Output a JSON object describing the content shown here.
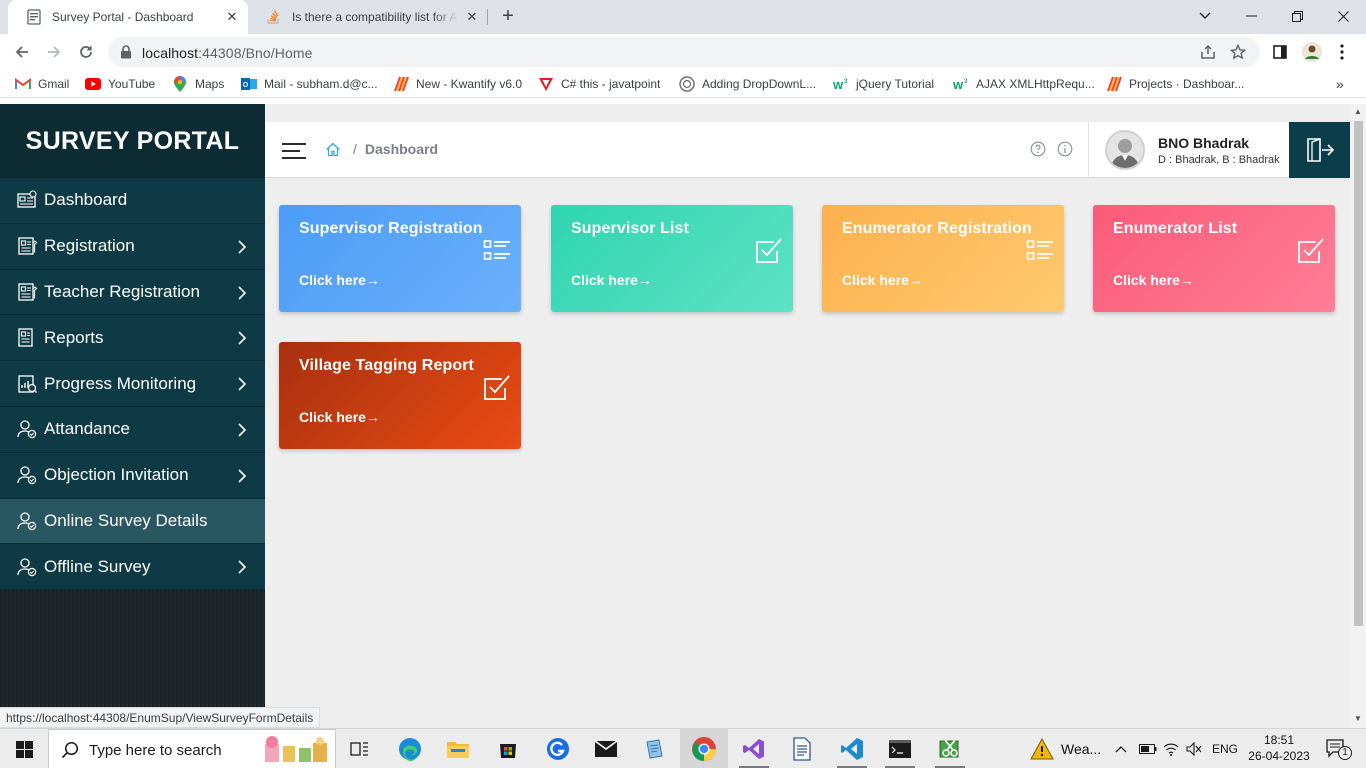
{
  "browser": {
    "tabs": [
      {
        "title": "Survey Portal - Dashboard",
        "active": true
      },
      {
        "title": "Is there a compatibility list for An",
        "active": false
      }
    ],
    "url_host": "localhost",
    "url_path": ":44308/Bno/Home",
    "bookmarks": [
      {
        "label": "Gmail",
        "icon": "gmail-icon"
      },
      {
        "label": "YouTube",
        "icon": "youtube-icon"
      },
      {
        "label": "Maps",
        "icon": "maps-icon"
      },
      {
        "label": "Mail - subham.d@c...",
        "icon": "outlook-icon"
      },
      {
        "label": "New - Kwantify v6.0",
        "icon": "kwantify-icon"
      },
      {
        "label": "C# this - javatpoint",
        "icon": "javatpoint-icon"
      },
      {
        "label": "Adding DropDownL...",
        "icon": "openai-icon"
      },
      {
        "label": "jQuery Tutorial",
        "icon": "w3schools-icon"
      },
      {
        "label": "AJAX XMLHttpRequ...",
        "icon": "w3schools-icon"
      },
      {
        "label": "Projects · Dashboar...",
        "icon": "kwantify-icon"
      }
    ],
    "status_url": "https://localhost:44308/EnumSup/ViewSurveyFormDetails"
  },
  "sidebar": {
    "brand": "SURVEY PORTAL",
    "items": [
      {
        "label": "Dashboard",
        "has_submenu": false
      },
      {
        "label": "Registration",
        "has_submenu": true
      },
      {
        "label": "Teacher Registration",
        "has_submenu": true
      },
      {
        "label": "Reports",
        "has_submenu": true
      },
      {
        "label": "Progress Monitoring",
        "has_submenu": true
      },
      {
        "label": "Attandance",
        "has_submenu": true
      },
      {
        "label": "Objection Invitation",
        "has_submenu": true
      },
      {
        "label": "Online Survey Details",
        "has_submenu": false,
        "active": true
      },
      {
        "label": "Offline Survey",
        "has_submenu": true
      }
    ]
  },
  "header": {
    "breadcrumb": "Dashboard",
    "user_name": "BNO Bhadrak",
    "user_detail": "D : Bhadrak, B : Bhadrak"
  },
  "cards": [
    {
      "title": "Supervisor Registration",
      "link": "Click here→",
      "icon": "list-icon",
      "color": "#4b9cf7"
    },
    {
      "title": "Supervisor List",
      "link": "Click here→",
      "icon": "checkbox-icon",
      "color": "#2fd5b0"
    },
    {
      "title": "Enumerator Registration",
      "link": "Click here→",
      "icon": "list-icon",
      "color": "#fdb04e"
    },
    {
      "title": "Enumerator List",
      "link": "Click here→",
      "icon": "checkbox-icon",
      "color": "#fb5a78"
    },
    {
      "title": "Village Tagging Report",
      "link": "Click here→",
      "icon": "checkbox-icon",
      "color": "#c23a12"
    }
  ],
  "taskbar": {
    "search_placeholder": "Type here to search",
    "weather": "Wea...",
    "language": "ENG",
    "time": "18:51",
    "date": "26-04-2023",
    "notification_count": "1"
  },
  "colors": {
    "sidebar": "#0e3a45",
    "sidebar_active": "#285661",
    "brand_bg": "#0c2b33",
    "logout_bg": "#0b3d4b"
  }
}
